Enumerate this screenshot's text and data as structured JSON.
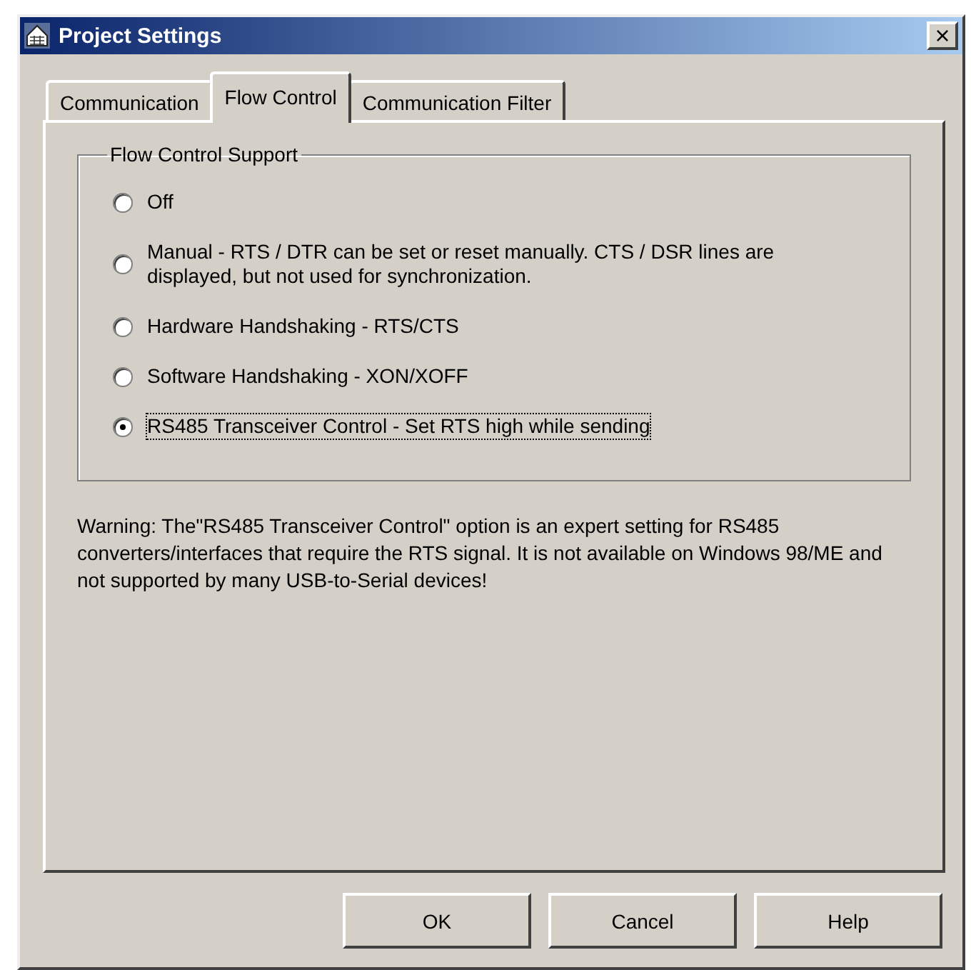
{
  "window": {
    "title": "Project Settings",
    "close": "×"
  },
  "tabs": [
    {
      "label": "Communication",
      "selected": false
    },
    {
      "label": "Flow Control",
      "selected": true
    },
    {
      "label": "Communication Filter",
      "selected": false
    }
  ],
  "group": {
    "title": "Flow Control Support",
    "options": [
      {
        "label": "Off",
        "selected": false
      },
      {
        "label": "Manual  -  RTS / DTR can be set or reset manually. CTS / DSR lines are displayed, but not used for synchronization.",
        "selected": false
      },
      {
        "label": "Hardware Handshaking - RTS/CTS",
        "selected": false
      },
      {
        "label": "Software Handshaking -  XON/XOFF",
        "selected": false
      },
      {
        "label": "RS485 Transceiver Control - Set RTS high while sending",
        "selected": true
      }
    ]
  },
  "warning": "Warning: The\"RS485 Transceiver Control\" option is an expert setting for RS485 converters/interfaces that require the RTS signal. It is not available on Windows 98/ME and not supported by many USB-to-Serial devices!",
  "buttons": [
    "OK",
    "Cancel",
    "Help"
  ]
}
